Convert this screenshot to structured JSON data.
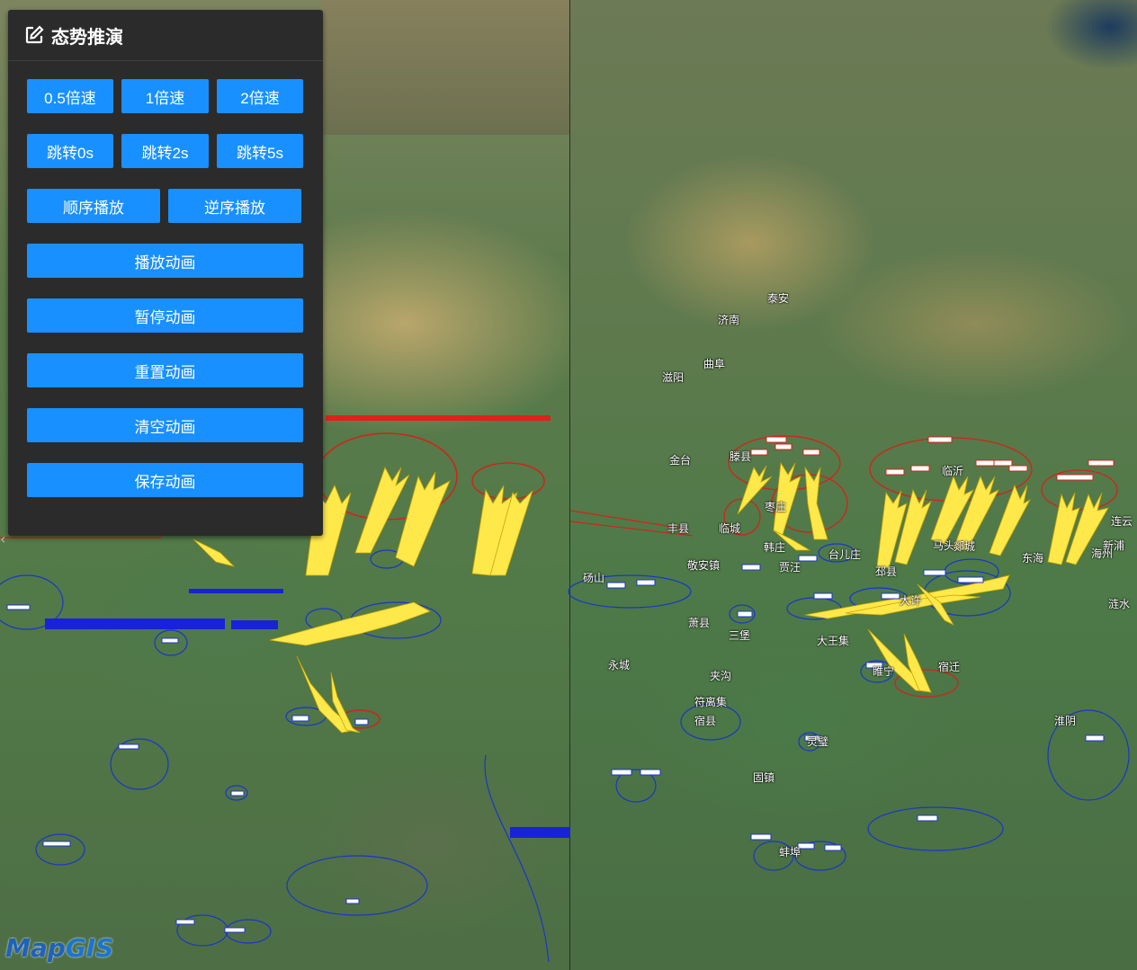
{
  "panel": {
    "title": "态势推演",
    "buttons": {
      "speed_05": "0.5倍速",
      "speed_1": "1倍速",
      "speed_2": "2倍速",
      "jump_0": "跳转0s",
      "jump_2": "跳转2s",
      "jump_5": "跳转5s",
      "forward": "顺序播放",
      "reverse": "逆序播放",
      "play": "播放动画",
      "pause": "暂停动画",
      "reset": "重置动画",
      "clear": "清空动画",
      "save": "保存动画"
    }
  },
  "logo": {
    "text_1": "Map",
    "text_2": "GIS"
  },
  "map_right": {
    "cities": [
      "泰安",
      "济南",
      "曲阜",
      "滋阳",
      "金台",
      "丰县",
      "滕县",
      "枣庄",
      "临沂",
      "临城",
      "韩庄",
      "台儿庄",
      "贾汪",
      "邳县",
      "东海",
      "新浦",
      "海州",
      "砀山",
      "敬安镇",
      "萧县",
      "三堡",
      "大王集",
      "宿迁",
      "睢宁",
      "永城",
      "宿县",
      "夹沟",
      "符离集",
      "固镇",
      "灵璧",
      "蚌埠",
      "涟水",
      "淮阴",
      "连云",
      "马头",
      "郯城",
      "大许"
    ]
  },
  "colors": {
    "button": "#1890ff",
    "panel": "#2b2b2b",
    "attack_arrow": "#ffe84a",
    "friendly": "#1b2fd6",
    "enemy": "#e0201a"
  }
}
